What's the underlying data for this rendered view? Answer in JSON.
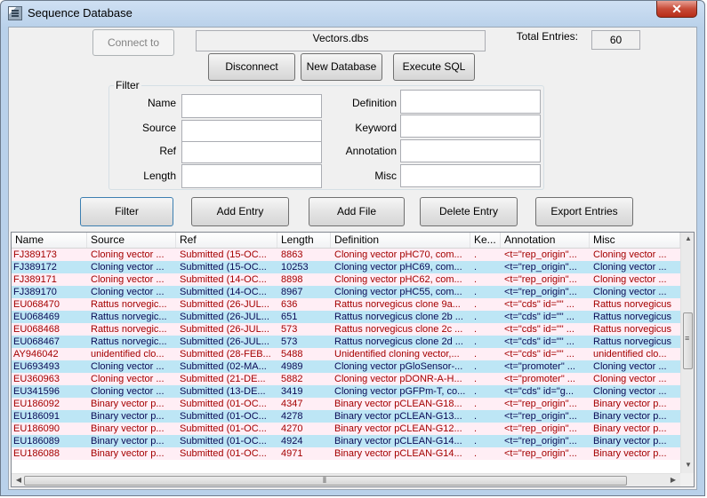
{
  "window": {
    "title": "Sequence Database",
    "close_glyph": "✕"
  },
  "toolbar": {
    "connect_label": "Connect to",
    "db_name": "Vectors.dbs",
    "total_label": "Total Entries:",
    "total_value": "60",
    "disconnect_label": "Disconnect",
    "new_db_label": "New Database",
    "execute_sql_label": "Execute SQL"
  },
  "filter": {
    "group_title": "Filter",
    "name_label": "Name",
    "source_label": "Source",
    "ref_label": "Ref",
    "length_label": "Length",
    "definition_label": "Definition",
    "keyword_label": "Keyword",
    "annotation_label": "Annotation",
    "misc_label": "Misc",
    "name_value": "",
    "source_value": "",
    "ref_value": "",
    "length_value": "",
    "definition_value": "",
    "keyword_value": "",
    "annotation_value": "",
    "misc_value": ""
  },
  "actions": {
    "filter_label": "Filter",
    "add_entry_label": "Add Entry",
    "add_file_label": "Add File",
    "delete_entry_label": "Delete Entry",
    "export_label": "Export Entries"
  },
  "grid": {
    "columns": [
      "Name",
      "Source",
      "Ref",
      "Length",
      "Definition",
      "Ke...",
      "Annotation",
      "Misc"
    ],
    "rows": [
      [
        "FJ389173",
        "Cloning vector ...",
        "Submitted (15-OC...",
        "8863",
        "Cloning vector pHC70, com...",
        ".",
        "<t=\"rep_origin\"...",
        "Cloning vector ..."
      ],
      [
        "FJ389172",
        "Cloning vector ...",
        "Submitted (15-OC...",
        "10253",
        "Cloning vector pHC69, com...",
        ".",
        "<t=\"rep_origin\"...",
        "Cloning vector ..."
      ],
      [
        "FJ389171",
        "Cloning vector ...",
        "Submitted (14-OC...",
        "8898",
        "Cloning vector pHC62, com...",
        ".",
        "<t=\"rep_origin\"...",
        "Cloning vector ..."
      ],
      [
        "FJ389170",
        "Cloning vector ...",
        "Submitted (14-OC...",
        "8967",
        "Cloning vector pHC55, com...",
        ".",
        "<t=\"rep_origin\"...",
        "Cloning vector ..."
      ],
      [
        "EU068470",
        "Rattus norvegic...",
        "Submitted (26-JUL...",
        "636",
        "Rattus norvegicus clone 9a...",
        ".",
        "<t=\"cds\" id=\"\" ...",
        "Rattus norvegicus"
      ],
      [
        "EU068469",
        "Rattus norvegic...",
        "Submitted (26-JUL...",
        "651",
        "Rattus norvegicus clone 2b ...",
        ".",
        "<t=\"cds\" id=\"\" ...",
        "Rattus norvegicus"
      ],
      [
        "EU068468",
        "Rattus norvegic...",
        "Submitted (26-JUL...",
        "573",
        "Rattus norvegicus clone 2c ...",
        ".",
        "<t=\"cds\" id=\"\" ...",
        "Rattus norvegicus"
      ],
      [
        "EU068467",
        "Rattus norvegic...",
        "Submitted (26-JUL...",
        "573",
        "Rattus norvegicus clone 2d ...",
        ".",
        "<t=\"cds\" id=\"\" ...",
        "Rattus norvegicus"
      ],
      [
        "AY946042",
        "unidentified clo...",
        "Submitted (28-FEB...",
        "5488",
        "Unidentified cloning vector,...",
        ".",
        "<t=\"cds\" id=\"\" ...",
        "unidentified clo..."
      ],
      [
        "EU693493",
        "Cloning vector ...",
        "Submitted (02-MA...",
        "4989",
        "Cloning vector pGloSensor-...",
        ".",
        "<t=\"promoter\" ...",
        "Cloning vector ..."
      ],
      [
        "EU360963",
        "Cloning vector ...",
        "Submitted (21-DE...",
        "5882",
        "Cloning vector pDONR-A-H...",
        ".",
        "<t=\"promoter\" ...",
        "Cloning vector ..."
      ],
      [
        "EU341596",
        "Cloning vector ...",
        "Submitted (13-DE...",
        "3419",
        "Cloning vector pGFPm-T, co...",
        ".",
        "<t=\"cds\" id=\"g...",
        "Cloning vector ..."
      ],
      [
        "EU186092",
        "Binary vector p...",
        "Submitted (01-OC...",
        "4347",
        "Binary vector pCLEAN-G18...",
        ".",
        "<t=\"rep_origin\"...",
        "Binary vector p..."
      ],
      [
        "EU186091",
        "Binary vector p...",
        "Submitted (01-OC...",
        "4278",
        "Binary vector pCLEAN-G13...",
        ".",
        "<t=\"rep_origin\"...",
        "Binary vector p..."
      ],
      [
        "EU186090",
        "Binary vector p...",
        "Submitted (01-OC...",
        "4270",
        "Binary vector pCLEAN-G12...",
        ".",
        "<t=\"rep_origin\"...",
        "Binary vector p..."
      ],
      [
        "EU186089",
        "Binary vector p...",
        "Submitted (01-OC...",
        "4924",
        "Binary vector pCLEAN-G14...",
        ".",
        "<t=\"rep_origin\"...",
        "Binary vector p..."
      ],
      [
        "EU186088",
        "Binary vector p...",
        "Submitted (01-OC...",
        "4971",
        "Binary vector pCLEAN-G14...",
        ".",
        "<t=\"rep_origin\"...",
        "Binary vector p..."
      ]
    ]
  },
  "scroll": {
    "up": "▲",
    "down": "▼",
    "left": "◀",
    "right": "▶",
    "vgrip": "≡",
    "hgrip": "⦀"
  }
}
